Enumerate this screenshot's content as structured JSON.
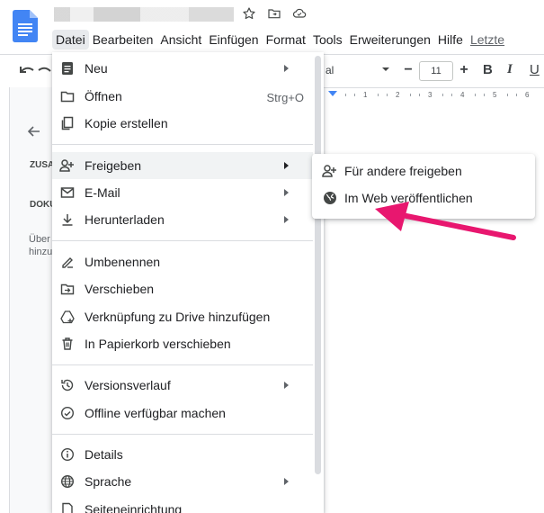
{
  "app": {
    "name": "Google Docs",
    "colors": {
      "brand": "#4285f4",
      "arrow": "#e8176f"
    }
  },
  "title_icons": [
    "star-icon",
    "move-to-folder-icon",
    "cloud-status-icon"
  ],
  "menubar": {
    "items": [
      "Datei",
      "Bearbeiten",
      "Ansicht",
      "Einfügen",
      "Format",
      "Tools",
      "Erweiterungen",
      "Hilfe"
    ],
    "last_edit": "Letzte"
  },
  "toolbar": {
    "font": "al",
    "font_size": "11",
    "minus": "−",
    "plus": "+",
    "bold": "B",
    "italic": "I",
    "underline": "U"
  },
  "ruler": {
    "ticks": [
      "1",
      "2",
      "3",
      "4",
      "5",
      "6"
    ]
  },
  "outline": {
    "zus": "ZUSA",
    "doku": "DOKU",
    "uber_line1": "Über",
    "uber_line2": "hinzu"
  },
  "file_menu": {
    "groups": [
      [
        {
          "label": "Neu",
          "icon": "document-icon",
          "submenu": true
        },
        {
          "label": "Öffnen",
          "icon": "folder-icon",
          "shortcut": "Strg+O"
        },
        {
          "label": "Kopie erstellen",
          "icon": "copy-icon"
        }
      ],
      [
        {
          "label": "Freigeben",
          "icon": "person-add-icon",
          "submenu": true,
          "highlighted": true
        },
        {
          "label": "E-Mail",
          "icon": "mail-icon",
          "submenu": true
        },
        {
          "label": "Herunterladen",
          "icon": "download-icon",
          "submenu": true
        }
      ],
      [
        {
          "label": "Umbenennen",
          "icon": "rename-icon"
        },
        {
          "label": "Verschieben",
          "icon": "move-icon"
        },
        {
          "label": "Verknüpfung zu Drive hinzufügen",
          "icon": "drive-shortcut-icon"
        },
        {
          "label": "In Papierkorb verschieben",
          "icon": "trash-icon"
        }
      ],
      [
        {
          "label": "Versionsverlauf",
          "icon": "history-icon",
          "submenu": true
        },
        {
          "label": "Offline verfügbar machen",
          "icon": "offline-icon"
        }
      ],
      [
        {
          "label": "Details",
          "icon": "info-icon"
        },
        {
          "label": "Sprache",
          "icon": "globe-icon",
          "submenu": true
        },
        {
          "label": "Seiteneinrichtung",
          "icon": "page-setup-icon"
        }
      ]
    ]
  },
  "share_submenu": {
    "items": [
      {
        "label": "Für andere freigeben",
        "icon": "person-add-icon"
      },
      {
        "label": "Im Web veröffentlichen",
        "icon": "globe-icon"
      }
    ]
  }
}
